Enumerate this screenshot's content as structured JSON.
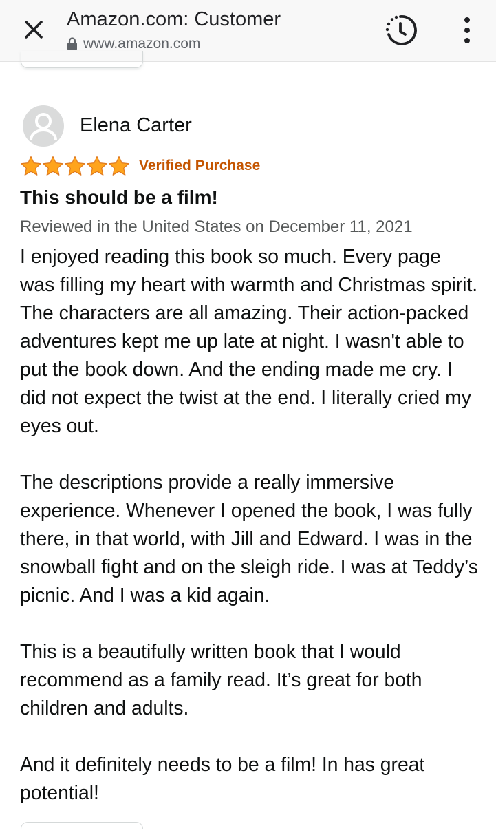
{
  "browser": {
    "title": "Amazon.com: Customer",
    "url": "www.amazon.com",
    "icons": {
      "close": "close-icon",
      "lock": "lock-icon",
      "history": "history-icon",
      "menu": "more-vert-icon"
    }
  },
  "review": {
    "reviewer_name": "Elena Carter",
    "rating": 5,
    "rating_max": 5,
    "star_color": "#ffa41c",
    "badge": "Verified Purchase",
    "badge_color": "#c45500",
    "title": "This should be a film!",
    "date_line": "Reviewed in the United States on December 11, 2021",
    "paragraphs": [
      "I enjoyed reading this book so much. Every page was filling my heart with warmth and Christmas spirit. The characters are all amazing. Their action-packed adventures kept me up late at night. I wasn't able to put the book down. And the ending made me cry. I did not expect the twist at the end. I literally cried my eyes out.",
      "The descriptions provide a really immersive experience. Whenever I opened the book, I was fully there, in that world, with Jill and Edward. I was in the snowball fight and on the sleigh ride. I was at Teddy’s picnic. And I was a kid again.",
      "This is a beautifully written book that I would recommend as a family read. It’s great for both children and adults.",
      "And it definitely needs to be a film! In has great potential!"
    ]
  }
}
